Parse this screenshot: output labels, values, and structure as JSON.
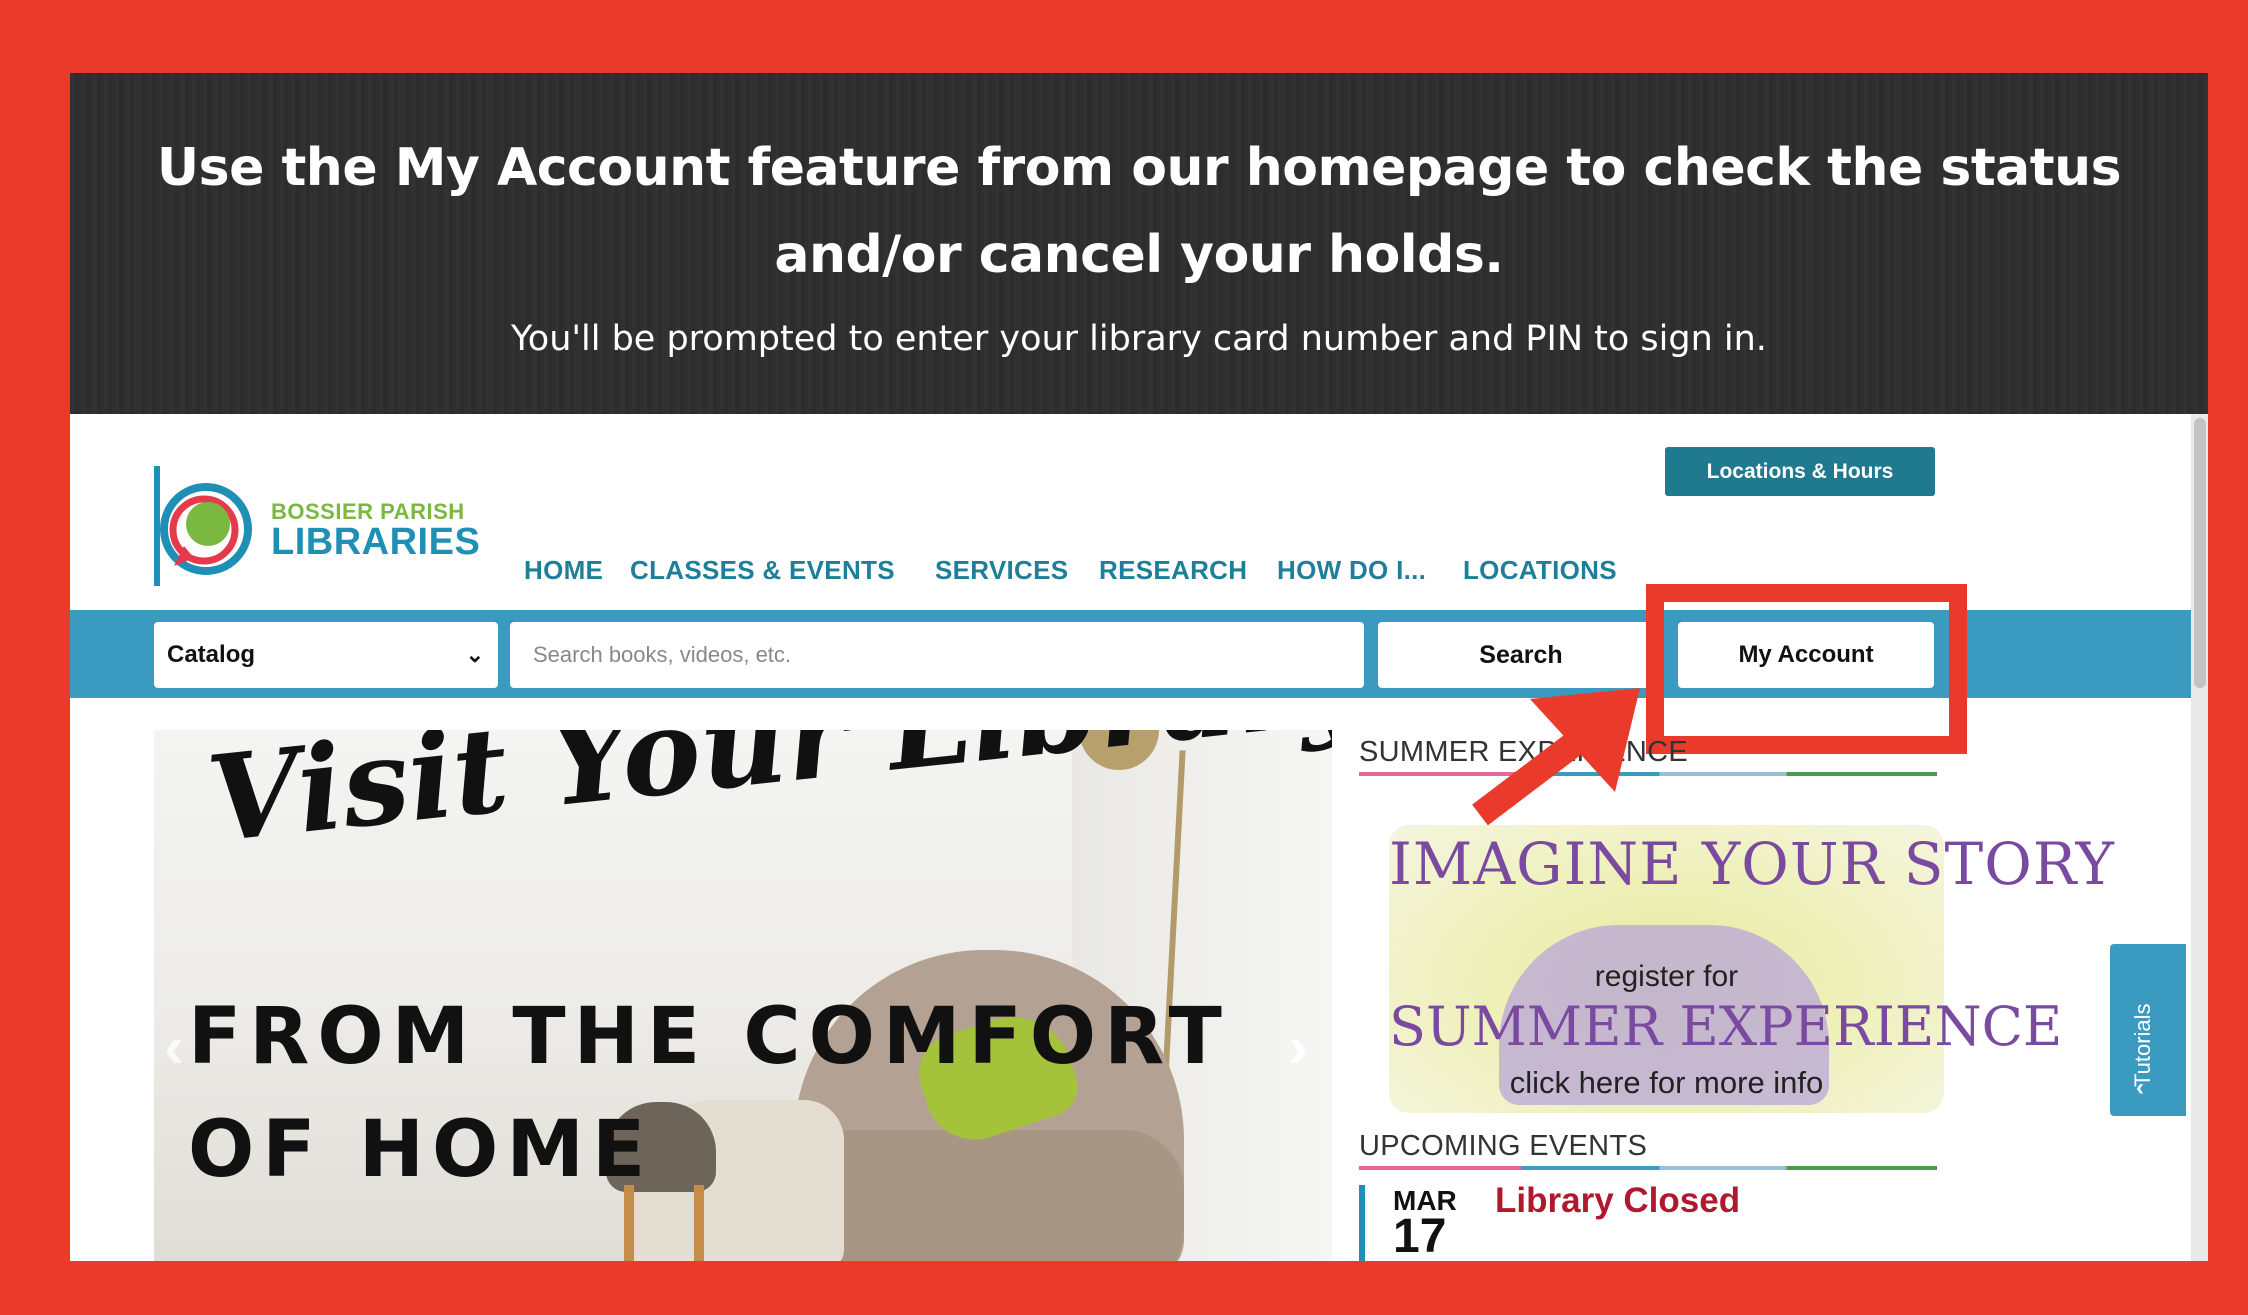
{
  "banner": {
    "title": "Use the My Account feature from our homepage to check the status and/or cancel your holds.",
    "subtitle": "You'll be prompted to enter your library card number and PIN to sign in."
  },
  "header": {
    "logo_top": "BOSSIER PARISH",
    "logo_bottom": "LIBRARIES",
    "locations_button": "Locations & Hours"
  },
  "nav": {
    "items": [
      "HOME",
      "CLASSES & EVENTS",
      "SERVICES",
      "RESEARCH",
      "HOW DO I...",
      "LOCATIONS"
    ]
  },
  "search": {
    "scope_selected": "Catalog",
    "placeholder": "Search books, videos, etc.",
    "search_button": "Search",
    "account_button": "My Account"
  },
  "hero": {
    "script_text": "Visit Your Library",
    "line1": "FROM THE COMFORT",
    "line2": "OF HOME",
    "prev_arrow": "‹",
    "next_arrow": "›"
  },
  "sidebar": {
    "summer_heading": "SUMMER EXPERIENCE",
    "promo_line1": "IMAGINE YOUR STORY",
    "promo_line2": "register for",
    "promo_line3": "SUMMER EXPERIENCE",
    "promo_line4": "click here for more info",
    "events_heading": "UPCOMING EVENTS",
    "event": {
      "month": "MAR",
      "day": "17",
      "title": "Library Closed"
    }
  },
  "tutorials_tab": "Tutorials",
  "colors": {
    "frame_red": "#ea3a2c",
    "brand_teal": "#1f8fb5",
    "search_bar": "#3b9abf",
    "event_red": "#b0182e"
  },
  "icons": {
    "dropdown": "chevron-down-icon",
    "tutorials": "chevron-left-icon",
    "callout": "arrow-icon"
  }
}
